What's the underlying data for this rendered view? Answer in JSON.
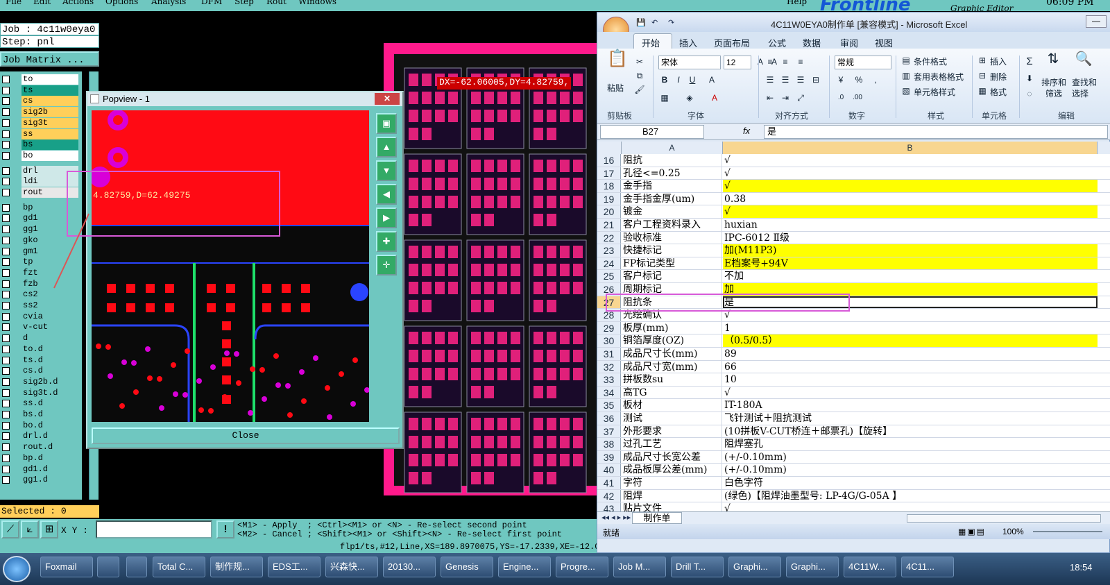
{
  "menu": {
    "items": [
      "File",
      "Edit",
      "Actions",
      "Options",
      "Analysis",
      "DFM",
      "Step",
      "Rout",
      "Windows"
    ],
    "help": "Help",
    "brand": "Frontline",
    "subtitle": "Graphic Editor",
    "time": "06:09 PM"
  },
  "left_panel": {
    "job": "Job : 4c11w0eya0",
    "step": "Step: pnl",
    "job_matrix": "Job Matrix ...",
    "selected": "Selected : 0",
    "layers": [
      {
        "name": "to",
        "color": "#ffffff"
      },
      {
        "name": "ts",
        "color": "#18a088"
      },
      {
        "name": "cs",
        "color": "#ffcf5a"
      },
      {
        "name": "sig2b",
        "color": "#ffcf5a"
      },
      {
        "name": "sig3t",
        "color": "#ffcf5a"
      },
      {
        "name": "ss",
        "color": "#ffcf5a"
      },
      {
        "name": "bs",
        "color": "#18a088"
      },
      {
        "name": "bo",
        "color": "#ffffff"
      },
      {
        "name": "drl",
        "color": "#cfe8e8"
      },
      {
        "name": "ldi",
        "color": "#cfe8e8"
      },
      {
        "name": "rout",
        "color": "#e8e8e8"
      },
      {
        "name": "bp",
        "color": "#6fc7c0"
      },
      {
        "name": "gd1",
        "color": "#6fc7c0"
      },
      {
        "name": "gg1",
        "color": "#6fc7c0"
      },
      {
        "name": "gko",
        "color": "#6fc7c0"
      },
      {
        "name": "gm1",
        "color": "#6fc7c0"
      },
      {
        "name": "tp",
        "color": "#6fc7c0"
      },
      {
        "name": "fzt",
        "color": "#6fc7c0"
      },
      {
        "name": "fzb",
        "color": "#6fc7c0"
      },
      {
        "name": "cs2",
        "color": "#6fc7c0"
      },
      {
        "name": "ss2",
        "color": "#6fc7c0"
      },
      {
        "name": "cvia",
        "color": "#6fc7c0"
      },
      {
        "name": "v-cut",
        "color": "#6fc7c0"
      },
      {
        "name": "d",
        "color": "#6fc7c0"
      },
      {
        "name": "to.d",
        "color": "#6fc7c0"
      },
      {
        "name": "ts.d",
        "color": "#6fc7c0"
      },
      {
        "name": "cs.d",
        "color": "#6fc7c0"
      },
      {
        "name": "sig2b.d",
        "color": "#6fc7c0"
      },
      {
        "name": "sig3t.d",
        "color": "#6fc7c0"
      },
      {
        "name": "ss.d",
        "color": "#6fc7c0"
      },
      {
        "name": "bs.d",
        "color": "#6fc7c0"
      },
      {
        "name": "bo.d",
        "color": "#6fc7c0"
      },
      {
        "name": "drl.d",
        "color": "#6fc7c0"
      },
      {
        "name": "rout.d",
        "color": "#6fc7c0"
      },
      {
        "name": "bp.d",
        "color": "#6fc7c0"
      },
      {
        "name": "gd1.d",
        "color": "#6fc7c0"
      },
      {
        "name": "gg1.d",
        "color": "#6fc7c0"
      }
    ]
  },
  "bottom": {
    "xy_label": "X Y :",
    "hint1": "<M1> - Apply  ; <Ctrl><M1> or <N> - Re-select second point",
    "hint2": "<M2> - Cancel ; <Shift><M1> or <Shift><N> - Re-select first point",
    "status": "flp1/ts,#12,Line,XS=189.8970075,YS=-17.2339,XE=-12.0"
  },
  "canvas": {
    "readout": "DX=-62.06005,DY=4.82759,"
  },
  "popview": {
    "title": "Popview - 1",
    "measure": "4.82759,D=62.49275",
    "close": "Close"
  },
  "excel": {
    "title": "4C11W0EYA0制作单 [兼容模式] - Microsoft Excel",
    "tabs": [
      "开始",
      "插入",
      "页面布局",
      "公式",
      "数据",
      "审阅",
      "视图"
    ],
    "ribbon": {
      "paste": "粘贴",
      "clipboard": "剪贴板",
      "font_name": "宋体",
      "font_size": "12",
      "font": "字体",
      "alignment": "对齐方式",
      "number_format": "常规",
      "number": "数字",
      "cond_format": "条件格式",
      "table_format": "套用表格格式",
      "cell_style": "单元格样式",
      "styles": "样式",
      "insert": "插入",
      "delete": "删除",
      "format": "格式",
      "cells": "单元格",
      "sort": "排序和",
      "filter": "筛选",
      "find": "查找和",
      "select": "选择",
      "editing": "编辑"
    },
    "name_box": "B27",
    "formula": "是",
    "col_a": "A",
    "col_b": "B",
    "rows": [
      {
        "n": "16",
        "a": "阻抗",
        "b": "√",
        "y": false
      },
      {
        "n": "17",
        "a": "孔径<=0.25",
        "b": "√",
        "y": false
      },
      {
        "n": "18",
        "a": "金手指",
        "b": "√",
        "y": true
      },
      {
        "n": "19",
        "a": "金手指金厚(um)",
        "b": "0.38",
        "y": false
      },
      {
        "n": "20",
        "a": "镀金",
        "b": "√",
        "y": true
      },
      {
        "n": "21",
        "a": "客户工程资料录入",
        "b": "huxian",
        "y": false
      },
      {
        "n": "22",
        "a": "验收标准",
        "b": "IPC-6012 Ⅱ级",
        "y": false
      },
      {
        "n": "23",
        "a": "快捷标记",
        "b": "加(M11P3)",
        "y": true
      },
      {
        "n": "24",
        "a": "FP标记类型",
        "b": "E档案号+94V",
        "y": true
      },
      {
        "n": "25",
        "a": "客户标记",
        "b": "不加",
        "y": false
      },
      {
        "n": "26",
        "a": "周期标记",
        "b": "加",
        "y": true
      },
      {
        "n": "27",
        "a": "阻抗条",
        "b": "是",
        "y": false
      },
      {
        "n": "28",
        "a": "光绘确认",
        "b": "√",
        "y": false
      },
      {
        "n": "29",
        "a": "板厚(mm)",
        "b": "1",
        "y": false
      },
      {
        "n": "30",
        "a": "铜箔厚度(OZ)",
        "b": "（0.5/0.5）",
        "y": true
      },
      {
        "n": "31",
        "a": "成品尺寸长(mm)",
        "b": "89",
        "y": false
      },
      {
        "n": "32",
        "a": "成品尺寸宽(mm)",
        "b": "66",
        "y": false
      },
      {
        "n": "33",
        "a": "拼板数su",
        "b": "10",
        "y": false
      },
      {
        "n": "34",
        "a": "高TG",
        "b": "√",
        "y": false
      },
      {
        "n": "35",
        "a": "板材",
        "b": "IT-180A",
        "y": false
      },
      {
        "n": "36",
        "a": "测试",
        "b": "飞针测试＋阻抗测试",
        "y": false
      },
      {
        "n": "37",
        "a": "外形要求",
        "b": "(10拼板V-CUT桥连＋邮票孔)【旋转】",
        "y": false
      },
      {
        "n": "38",
        "a": "过孔工艺",
        "b": "阻焊塞孔",
        "y": false
      },
      {
        "n": "39",
        "a": "成品尺寸长宽公差",
        "b": "(+/-0.10mm)",
        "y": false
      },
      {
        "n": "40",
        "a": "成品板厚公差(mm)",
        "b": "(+/-0.10mm)",
        "y": false
      },
      {
        "n": "41",
        "a": "字符",
        "b": "白色字符",
        "y": false
      },
      {
        "n": "42",
        "a": "阻焊",
        "b": "(绿色)【阻焊油墨型号: LP-4G/G-05A 】",
        "y": false
      },
      {
        "n": "43",
        "a": "贴片文件",
        "b": "√",
        "y": false
      }
    ],
    "sheet": "制作单",
    "status_ready": "就绪",
    "zoom": "100%"
  },
  "taskbar": {
    "items": [
      "Foxmail",
      "",
      "",
      "Total C...",
      "制作规...",
      "EDS工...",
      "兴森快...",
      "20130...",
      "Genesis",
      "Engine...",
      "Progre...",
      "Job M...",
      "Drill T...",
      "Graphi...",
      "Graphi...",
      "4C11W...",
      "4C11..."
    ],
    "clock": "18:54"
  }
}
